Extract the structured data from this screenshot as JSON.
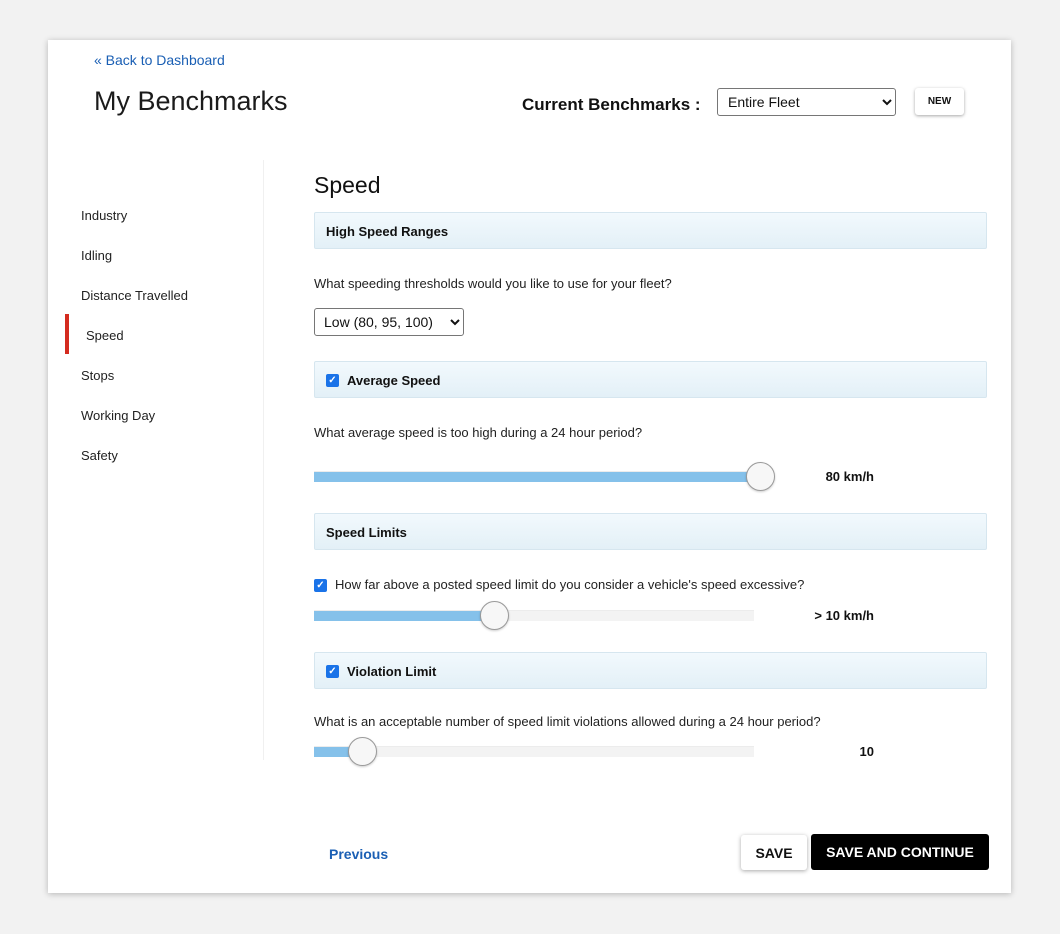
{
  "header": {
    "back_link": "« Back to Dashboard",
    "title": "My Benchmarks",
    "current_benchmarks_label": "Current Benchmarks :",
    "current_benchmarks_value": "Entire Fleet",
    "new_button": "NEW"
  },
  "sidebar": {
    "items": [
      {
        "label": "Industry"
      },
      {
        "label": "Idling"
      },
      {
        "label": "Distance Travelled"
      },
      {
        "label": "Speed"
      },
      {
        "label": "Stops"
      },
      {
        "label": "Working Day"
      },
      {
        "label": "Safety"
      }
    ],
    "active": "Speed"
  },
  "main": {
    "section_title": "Speed",
    "high_speed": {
      "header": "High Speed Ranges",
      "question": "What speeding thresholds would you like to use for your fleet?",
      "threshold_value": "Low (80, 95, 100)"
    },
    "average_speed": {
      "header": "Average Speed",
      "checked": true,
      "question": "What average speed is too high during a 24 hour period?",
      "slider_fraction": 0.97,
      "value_label": "80 km/h"
    },
    "speed_limits": {
      "header": "Speed Limits",
      "question": "How far above a posted speed limit do you consider a vehicle's speed excessive?",
      "checked": true,
      "slider_fraction": 0.41,
      "value_label": "> 10 km/h"
    },
    "violation_limit": {
      "header": "Violation Limit",
      "checked": true,
      "question": "What is an acceptable number of speed limit violations allowed during a 24 hour period?",
      "slider_fraction": 0.11,
      "value_label": "10"
    }
  },
  "footer": {
    "previous": "Previous",
    "save": "SAVE",
    "save_and_continue": "SAVE AND CONTINUE"
  },
  "colors": {
    "accent_link": "#1a5fb4",
    "active_indicator": "#d42b1f",
    "slider_fill": "#85c1ea",
    "checkbox": "#1a73e8"
  }
}
